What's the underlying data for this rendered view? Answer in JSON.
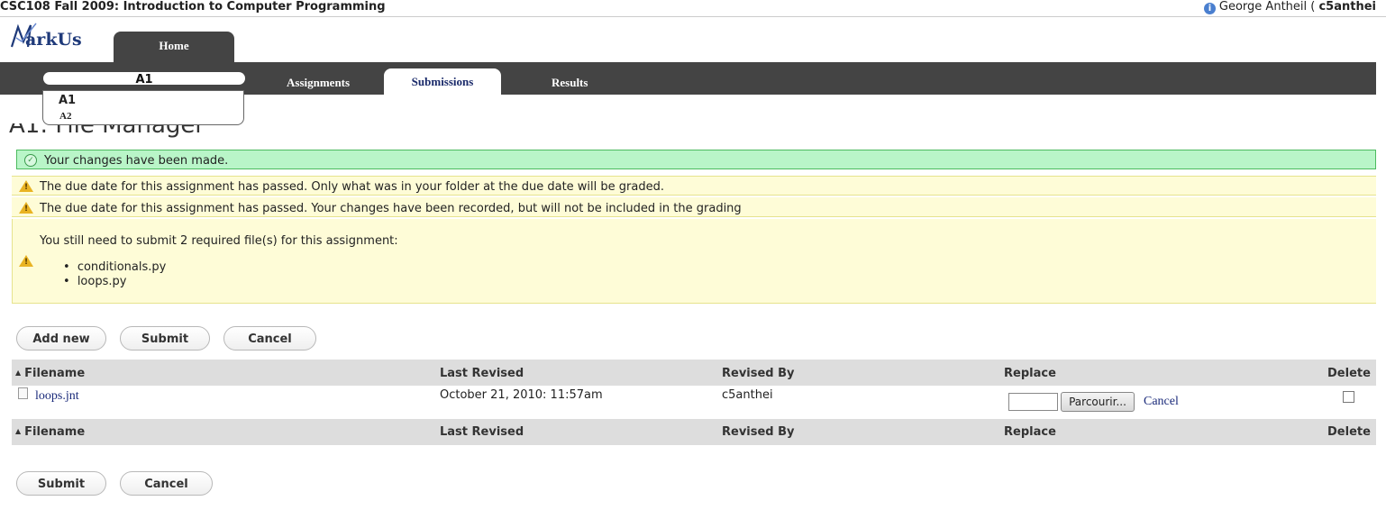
{
  "header": {
    "course_title": "CSC108 Fall 2009: Introduction to Computer Programming",
    "user_name": "George Antheil (",
    "user_id": "c5anthei"
  },
  "logo": {
    "text": "arkUs",
    "full": "MarkUs"
  },
  "nav": {
    "home": "Home",
    "assignment_selector": "A1",
    "assignment_options": [
      "A1",
      "A2"
    ],
    "tabs": [
      "Assignments",
      "Submissions",
      "Results"
    ],
    "active_tab": "Submissions"
  },
  "page": {
    "title": "A1: File Manager"
  },
  "notices": {
    "success": "Your changes have been made.",
    "warning_due_date": "The due date for this assignment has passed. Only what was in your folder at the due date will be graded.",
    "warning_recorded": "The due date for this assignment has passed. Your changes have been recorded, but will not be included in the grading",
    "required_intro": "You still need to submit 2 required file(s) for this assignment:",
    "required_files": [
      "conditionals.py",
      "loops.py"
    ]
  },
  "actions": {
    "add_new": "Add new",
    "submit": "Submit",
    "cancel": "Cancel"
  },
  "table": {
    "columns": [
      "Filename",
      "Last Revised",
      "Revised By",
      "Replace",
      "Delete"
    ],
    "rows": [
      {
        "filename": "loops.jnt",
        "last_revised": "October 21, 2010: 11:57am",
        "revised_by": "c5anthei",
        "browse_label": "Parcourir...",
        "cancel_label": "Cancel",
        "delete_checked": false
      }
    ]
  },
  "colors": {
    "navbar": "#444444",
    "success_bg": "#b9f5c8",
    "warning_bg": "#fefcd7",
    "link": "#1a2a7a"
  }
}
